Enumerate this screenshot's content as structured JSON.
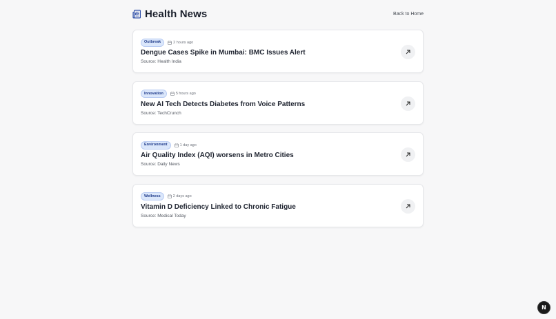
{
  "header": {
    "title": "Health News",
    "title_icon": "newspaper-icon",
    "back_label": "Back to Home"
  },
  "articles": [
    {
      "category": "Outbreak",
      "time": "2 hours ago",
      "title": "Dengue Cases Spike in Mumbai: BMC Issues Alert",
      "source": "Source: Health India"
    },
    {
      "category": "Innovation",
      "time": "5 hours ago",
      "title": "New AI Tech Detects Diabetes from Voice Patterns",
      "source": "Source: TechCrunch"
    },
    {
      "category": "Environment",
      "time": "1 day ago",
      "title": "Air Quality Index (AQI) worsens in Metro Cities",
      "source": "Source: Daily News"
    },
    {
      "category": "Wellness",
      "time": "2 days ago",
      "title": "Vitamin D Deficiency Linked to Chronic Fatigue",
      "source": "Source: Medical Today"
    }
  ],
  "floating_badge": {
    "letter": "N"
  },
  "colors": {
    "background": "#f7f7f8",
    "badge_bg": "#dbe7fb",
    "badge_text": "#1e3a8a",
    "accent_icon": "#2f4fa8"
  }
}
